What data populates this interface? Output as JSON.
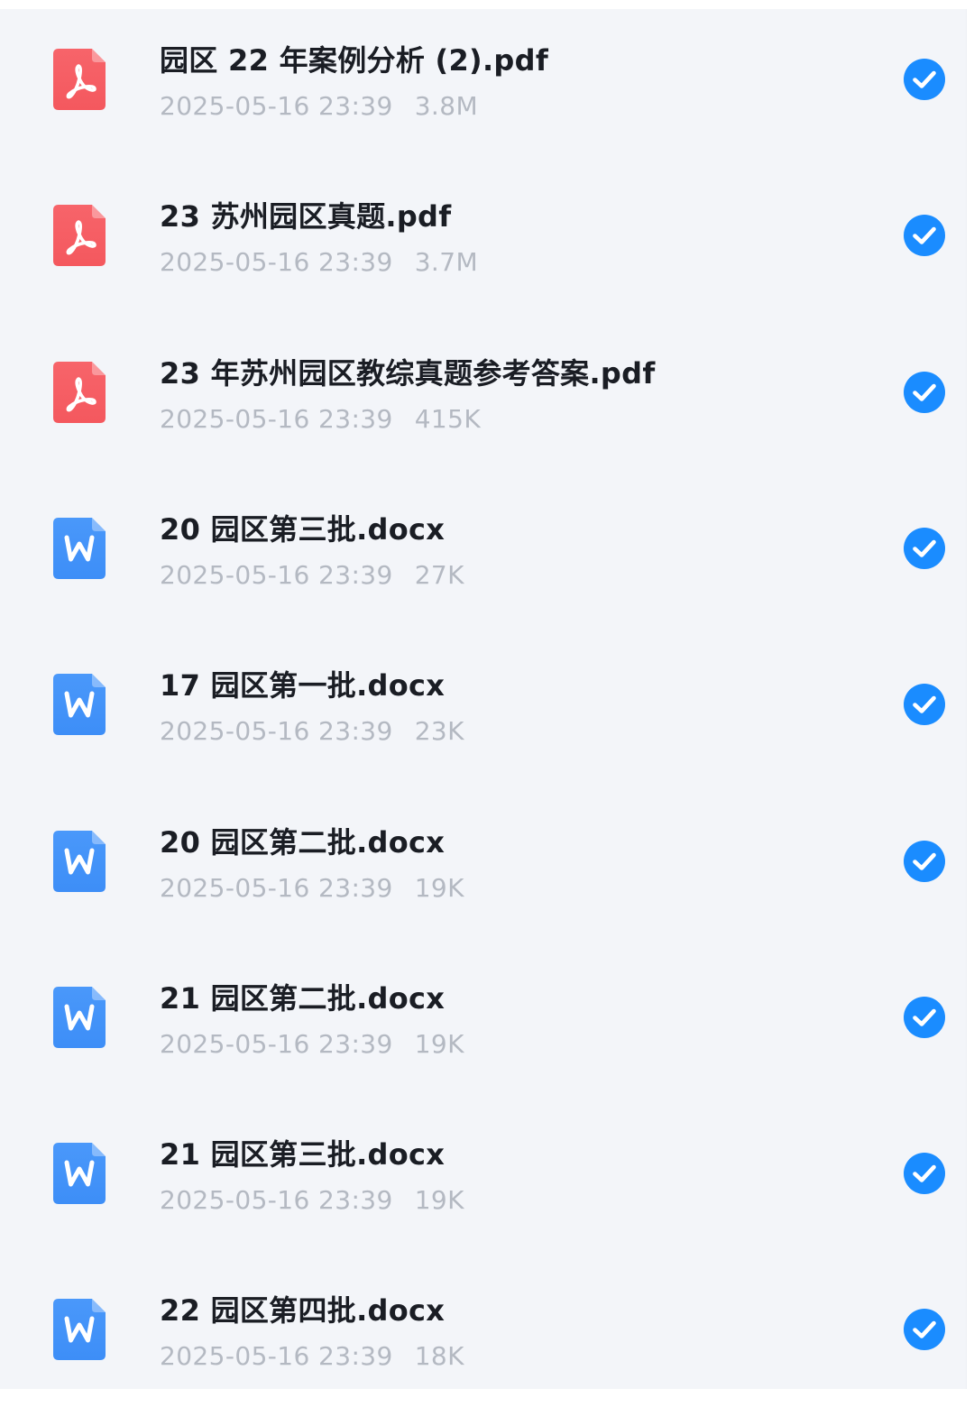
{
  "files": [
    {
      "name": "园区 22 年案例分析 (2).pdf",
      "date": "2025-05-16 23:39",
      "size": "3.8M",
      "type": "pdf",
      "icon": "pdf-file-icon",
      "selected": true
    },
    {
      "name": "23 苏州园区真题.pdf",
      "date": "2025-05-16 23:39",
      "size": "3.7M",
      "type": "pdf",
      "icon": "pdf-file-icon",
      "selected": true
    },
    {
      "name": "23 年苏州园区教综真题参考答案.pdf",
      "date": "2025-05-16 23:39",
      "size": "415K",
      "type": "pdf",
      "icon": "pdf-file-icon",
      "selected": true
    },
    {
      "name": "20 园区第三批.docx",
      "date": "2025-05-16 23:39",
      "size": "27K",
      "type": "docx",
      "icon": "word-file-icon",
      "selected": true
    },
    {
      "name": "17 园区第一批.docx",
      "date": "2025-05-16 23:39",
      "size": "23K",
      "type": "docx",
      "icon": "word-file-icon",
      "selected": true
    },
    {
      "name": "20 园区第二批.docx",
      "date": "2025-05-16 23:39",
      "size": "19K",
      "type": "docx",
      "icon": "word-file-icon",
      "selected": true
    },
    {
      "name": "21 园区第二批.docx",
      "date": "2025-05-16 23:39",
      "size": "19K",
      "type": "docx",
      "icon": "word-file-icon",
      "selected": true
    },
    {
      "name": "21 园区第三批.docx",
      "date": "2025-05-16 23:39",
      "size": "19K",
      "type": "docx",
      "icon": "word-file-icon",
      "selected": true
    },
    {
      "name": "22 园区第四批.docx",
      "date": "2025-05-16 23:39",
      "size": "18K",
      "type": "docx",
      "icon": "word-file-icon",
      "selected": true
    }
  ],
  "colors": {
    "pdf_icon": "#f4585e",
    "word_icon": "#3d8ef7",
    "check": "#1a8cff",
    "name_text": "#1a1d24",
    "meta_text": "#b4b9c2",
    "list_background": "#f3f5f9"
  }
}
